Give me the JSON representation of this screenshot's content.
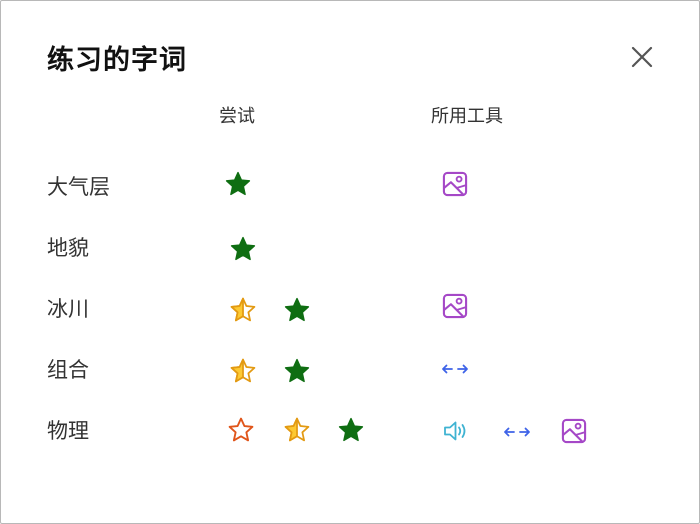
{
  "dialog": {
    "title": "练习的字词",
    "close_icon": "close-icon"
  },
  "columns": {
    "attempts": "尝试",
    "tools": "所用工具"
  },
  "colors": {
    "star_success": "#0f6e12",
    "star_partial_fill": "#fdc932",
    "star_partial_outline": "#e39a12",
    "star_fail_outline": "#e0551a",
    "tool_picture": "#a548c7",
    "tool_syllables": "#3e63e8",
    "tool_audio": "#3fb3d2"
  },
  "rows": [
    {
      "word": "大气层",
      "attempts": [
        "success"
      ],
      "tools": [
        "picture-dictionary-icon"
      ]
    },
    {
      "word": "地貌",
      "attempts": [
        "success"
      ],
      "tools": []
    },
    {
      "word": "冰川",
      "attempts": [
        "partial",
        "success"
      ],
      "tools": [
        "picture-dictionary-icon"
      ]
    },
    {
      "word": "组合",
      "attempts": [
        "partial",
        "success"
      ],
      "tools": [
        "syllables-icon"
      ]
    },
    {
      "word": "物理",
      "attempts": [
        "fail",
        "partial",
        "success"
      ],
      "tools": [
        "read-aloud-icon",
        "syllables-icon",
        "picture-dictionary-icon"
      ]
    }
  ]
}
